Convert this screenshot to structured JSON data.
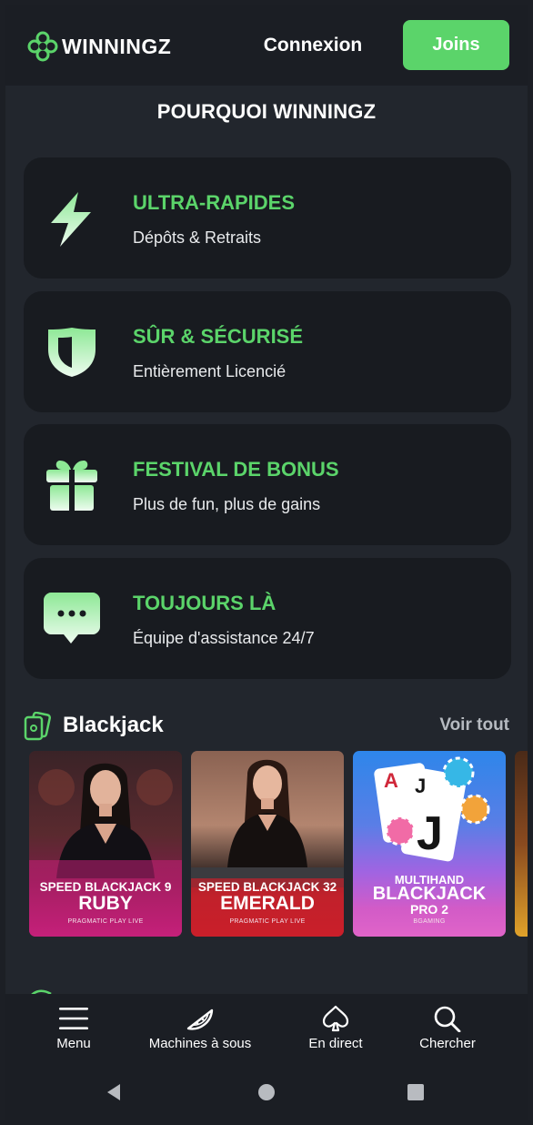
{
  "header": {
    "logo_text": "WINNINGZ",
    "login_label": "Connexion",
    "join_label": "Joins"
  },
  "why": {
    "title": "POURQUOI WINNINGZ",
    "features": [
      {
        "title": "ULTRA-RAPIDES",
        "subtitle": "Dépôts & Retraits",
        "icon": "lightning-icon"
      },
      {
        "title": "SÛR & SÉCURISÉ",
        "subtitle": "Entièrement Licencié",
        "icon": "shield-icon"
      },
      {
        "title": "FESTIVAL DE BONUS",
        "subtitle": "Plus de fun, plus de gains",
        "icon": "gift-icon"
      },
      {
        "title": "TOUJOURS LÀ",
        "subtitle": "Équipe d'assistance 24/7",
        "icon": "chat-icon"
      }
    ]
  },
  "blackjack": {
    "title": "Blackjack",
    "see_all": "Voir tout",
    "games": [
      {
        "line1": "SPEED BLACKJACK 9",
        "line2": "RUBY",
        "provider": "PRAGMATIC PLAY LIVE"
      },
      {
        "line1": "SPEED BLACKJACK 32",
        "line2": "EMERALD",
        "provider": "PRAGMATIC PLAY LIVE"
      },
      {
        "line1": "MULTIHAND",
        "line2": "BLACKJACK",
        "line3": "PRO 2",
        "provider": "BGAMING"
      }
    ]
  },
  "bottom_nav": [
    {
      "label": "Menu",
      "icon": "hamburger-icon"
    },
    {
      "label": "Machines à sous",
      "icon": "watermelon-icon"
    },
    {
      "label": "En direct",
      "icon": "spade-icon"
    },
    {
      "label": "Chercher",
      "icon": "search-icon"
    }
  ],
  "system_nav": [
    "back-icon",
    "home-icon",
    "recents-icon"
  ],
  "colors": {
    "accent": "#5bd46a",
    "background": "#22262d",
    "card_bg": "#181b20"
  }
}
